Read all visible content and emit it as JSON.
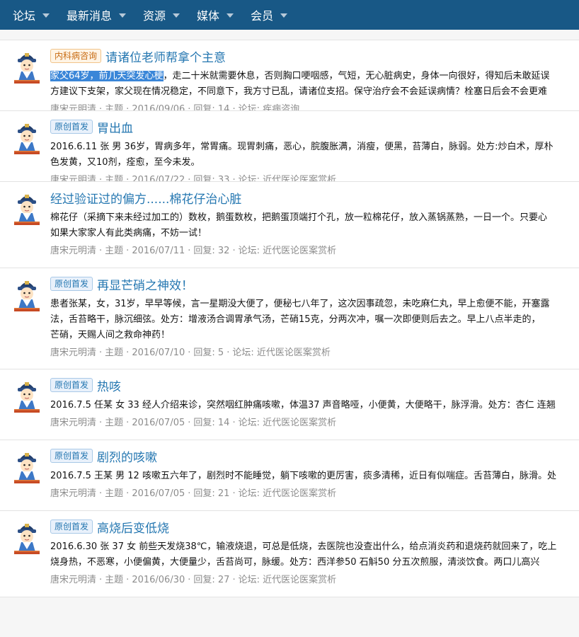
{
  "nav": [
    "论坛",
    "最新消息",
    "资源",
    "媒体",
    "会员"
  ],
  "threads": [
    {
      "prefix": "内科病咨询",
      "prefix_style": "orange",
      "title": "请诸位老师帮拿个主意",
      "highlight": "家父64岁，前几天突发心梗",
      "lines": [
        "，走二十米就需要休息，否则胸口哽咽感，气短，无心脏病史，身体一向很好，得知后未敢延误",
        "方建议下支架，家父现在情况稳定，不同意下，我方寸已乱，请诸位支招。保守治疗会不会延误病情？栓塞日后会不会更难"
      ],
      "author": "唐宋元明清",
      "type": "主题",
      "date": "2016/09/06",
      "replies_label": "回复: 14",
      "forum_label": "论坛: 疾病咨询"
    },
    {
      "prefix": "原创首发",
      "prefix_style": "blue",
      "title": "胃出血",
      "lines": [
        "2016.6.11 张 男 36岁，胃病多年，常胃痛。现胃刺痛，恶心，脘腹胀满，消瘦，便黑，苔薄白，脉弱。处方:炒白术，厚朴",
        "色发黄，又10剂，痊愈，至今未发。"
      ],
      "author": "唐宋元明清",
      "type": "主题",
      "date": "2016/07/22",
      "replies_label": "回复: 33",
      "forum_label": "论坛: 近代医论医案赏析"
    },
    {
      "prefix": "",
      "prefix_style": "",
      "title": "经过验证过的偏方......棉花仔治心脏",
      "lines": [
        "棉花仔（采摘下来未经过加工的）数枚，鹅蛋数枚，把鹅蛋顶端打个孔，放一粒棉花仔，放入蒸锅蒸熟，一日一个。只要心",
        "如果大家家人有此类病痛，不妨一试！"
      ],
      "author": "唐宋元明清",
      "type": "主题",
      "date": "2016/07/11",
      "replies_label": "回复: 32",
      "forum_label": "论坛: 近代医论医案赏析"
    },
    {
      "prefix": "原创首发",
      "prefix_style": "blue",
      "title": "再显芒硝之神效！",
      "lines": [
        "患者张某，女，31岁，早早等候，言一星期没大便了，便秘七八年了，这次因事疏忽，未吃麻仁丸，早上愈便不能，开塞露",
        "法，舌苔略干，脉沉细弦。处方：增液汤合调胃承气汤，芒硝15克，分两次冲，嘱一次即便则后去之。早上八点半走的，",
        "芒硝，天赐人间之救命神药！"
      ],
      "author": "唐宋元明清",
      "type": "主题",
      "date": "2016/07/10",
      "replies_label": "回复: 5",
      "forum_label": "论坛: 近代医论医案赏析"
    },
    {
      "prefix": "原创首发",
      "prefix_style": "blue",
      "title": "热咳",
      "lines": [
        "2016.7.5 任某 女 33 经人介绍来诊，突然咽红肿痛咳嗽，体温37 声音略哑，小便黄，大便略干，脉浮滑。处方：杏仁 连翘"
      ],
      "author": "唐宋元明清",
      "type": "主题",
      "date": "2016/07/05",
      "replies_label": "回复: 14",
      "forum_label": "论坛: 近代医论医案赏析"
    },
    {
      "prefix": "原创首发",
      "prefix_style": "blue",
      "title": "剧烈的咳嗽",
      "lines": [
        "2016.7.5 王某 男 12 咳嗽五六年了，剧烈时不能睡觉，躺下咳嗽的更厉害，痰多清稀，近日有似喘症。舌苔薄白，脉滑。处"
      ],
      "author": "唐宋元明清",
      "type": "主题",
      "date": "2016/07/05",
      "replies_label": "回复: 21",
      "forum_label": "论坛: 近代医论医案赏析"
    },
    {
      "prefix": "原创首发",
      "prefix_style": "blue",
      "title": "高烧后变低烧",
      "lines": [
        "2016.6.30 张 37 女 前些天发烧38℃，输液烧退，可总是低烧，去医院也没查出什么，给点消炎药和退烧药就回来了，吃上",
        "烧身热，不恶寒，小便偏黄，大便量少，舌苔尚可，脉缓。处方：西洋参50 石斛50 分五次煎服，清淡饮食。两口儿高兴"
      ],
      "author": "唐宋元明清",
      "type": "主题",
      "date": "2016/06/30",
      "replies_label": "回复: 27",
      "forum_label": "论坛: 近代医论医案赏析"
    }
  ]
}
